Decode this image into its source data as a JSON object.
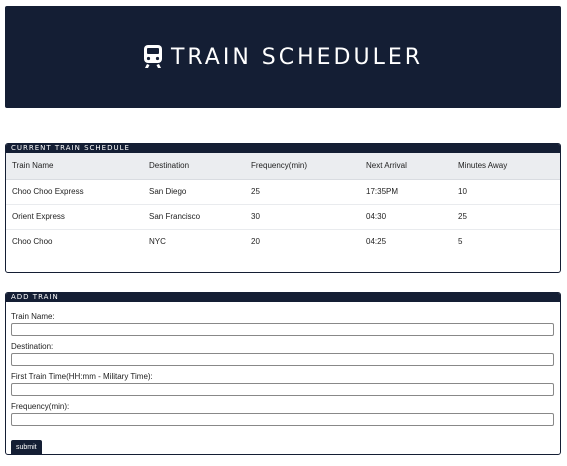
{
  "header": {
    "title": "TRAIN SCHEDULER",
    "icon": "train-icon"
  },
  "schedule": {
    "heading": "CURRENT TRAIN SCHEDULE",
    "columns": [
      "Train Name",
      "Destination",
      "Frequency(min)",
      "Next Arrival",
      "Minutes Away"
    ],
    "rows": [
      [
        "Choo Choo Express",
        "San Diego",
        "25",
        "17:35PM",
        "10"
      ],
      [
        "Orient Express",
        "San Francisco",
        "30",
        "04:30",
        "25"
      ],
      [
        "Choo Choo",
        "NYC",
        "20",
        "04:25",
        "5"
      ]
    ]
  },
  "add_train": {
    "heading": "ADD TRAIN",
    "fields": [
      {
        "label": "Train Name:",
        "value": "",
        "placeholder": ""
      },
      {
        "label": "Destination:",
        "value": "",
        "placeholder": ""
      },
      {
        "label": "First Train Time(HH:mm - Military Time):",
        "value": "",
        "placeholder": ""
      },
      {
        "label": "Frequency(min):",
        "value": "",
        "placeholder": ""
      }
    ],
    "submit_label": "submit"
  },
  "colors": {
    "navy": "#141e34",
    "header_row": "#ebedf0"
  }
}
